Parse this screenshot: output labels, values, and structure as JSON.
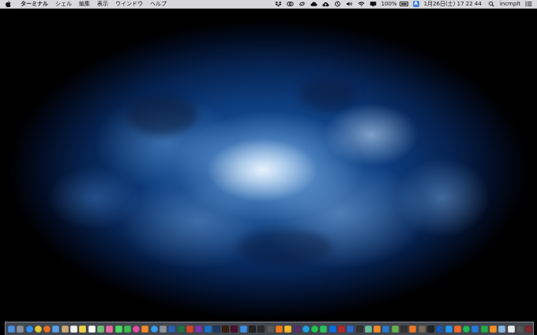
{
  "menubar": {
    "app_name": "ターミナル",
    "menus": [
      "シェル",
      "編集",
      "表示",
      "ウインドウ",
      "ヘルプ"
    ],
    "battery": "100%",
    "input_source": "A",
    "datetime": "1月26日(土)  17 22 44",
    "username": "incmplt"
  },
  "status_icons": [
    "dropbox-icon",
    "creative-cloud-icon",
    "sync-icon",
    "cloud-icon",
    "upload-icon",
    "time-machine-icon",
    "volume-icon",
    "wifi-icon",
    "display-icon"
  ],
  "dock": {
    "apps": [
      {
        "name": "finder",
        "color": "#4a90e2"
      },
      {
        "name": "launchpad",
        "color": "#8a8f98"
      },
      {
        "name": "safari",
        "color": "#2f8ef0"
      },
      {
        "name": "chrome",
        "color": "#e6c63a"
      },
      {
        "name": "firefox",
        "color": "#e8702a"
      },
      {
        "name": "mail",
        "color": "#5aa0e8"
      },
      {
        "name": "contacts",
        "color": "#c9a97a"
      },
      {
        "name": "calendar",
        "color": "#f2f2f2"
      },
      {
        "name": "notes",
        "color": "#f0d24a"
      },
      {
        "name": "reminders",
        "color": "#f5f5f5"
      },
      {
        "name": "maps",
        "color": "#6fbf73"
      },
      {
        "name": "photos",
        "color": "#e86aa0"
      },
      {
        "name": "messages",
        "color": "#4cd964"
      },
      {
        "name": "facetime",
        "color": "#3fb950"
      },
      {
        "name": "itunes",
        "color": "#e24fa0"
      },
      {
        "name": "ibooks",
        "color": "#f08a2a"
      },
      {
        "name": "app-store",
        "color": "#3aa0f0"
      },
      {
        "name": "preferences",
        "color": "#8d9199"
      },
      {
        "name": "word",
        "color": "#2b5fb4"
      },
      {
        "name": "excel",
        "color": "#217346"
      },
      {
        "name": "powerpoint",
        "color": "#d24726"
      },
      {
        "name": "onenote",
        "color": "#7b3aa8"
      },
      {
        "name": "outlook",
        "color": "#1a73c8"
      },
      {
        "name": "photoshop",
        "color": "#1e3a5f"
      },
      {
        "name": "illustrator",
        "color": "#3a1f0c"
      },
      {
        "name": "indesign",
        "color": "#4a1030"
      },
      {
        "name": "xcode",
        "color": "#3f8fe0"
      },
      {
        "name": "terminal",
        "color": "#222222"
      },
      {
        "name": "activity-monitor",
        "color": "#2a2a2a"
      },
      {
        "name": "console",
        "color": "#5a5a5a"
      },
      {
        "name": "vlc",
        "color": "#f07a1a"
      },
      {
        "name": "sketch",
        "color": "#f5b82e"
      },
      {
        "name": "slack",
        "color": "#5a2f6a"
      },
      {
        "name": "skype",
        "color": "#1fa3e0"
      },
      {
        "name": "line",
        "color": "#1fc74a"
      },
      {
        "name": "evernote",
        "color": "#2dbe60"
      },
      {
        "name": "dropbox",
        "color": "#0d6ddd"
      },
      {
        "name": "filezilla",
        "color": "#b22a2a"
      },
      {
        "name": "sourcetree",
        "color": "#2a6ac8"
      },
      {
        "name": "github",
        "color": "#333333"
      },
      {
        "name": "atom",
        "color": "#6bbf9a"
      },
      {
        "name": "sublime",
        "color": "#f28b2a"
      },
      {
        "name": "vscode",
        "color": "#2a7ac8"
      },
      {
        "name": "android-studio",
        "color": "#6ab04c"
      },
      {
        "name": "unity",
        "color": "#333333"
      },
      {
        "name": "blender",
        "color": "#e87a2a"
      },
      {
        "name": "gimp",
        "color": "#7a6a5a"
      },
      {
        "name": "inkscape",
        "color": "#222222"
      },
      {
        "name": "virtualbox",
        "color": "#1a5ab0"
      },
      {
        "name": "docker",
        "color": "#2496ed"
      },
      {
        "name": "postman",
        "color": "#f06a2a"
      },
      {
        "name": "spotify",
        "color": "#1db954"
      },
      {
        "name": "keynote",
        "color": "#2a7ad8"
      },
      {
        "name": "numbers",
        "color": "#2aa84a"
      },
      {
        "name": "pages",
        "color": "#f0902a"
      },
      {
        "name": "preview",
        "color": "#8ab4e0"
      },
      {
        "name": "textedit",
        "color": "#e8e8e8"
      },
      {
        "name": "calculator",
        "color": "#555555"
      },
      {
        "name": "dictionary",
        "color": "#7a2a2a"
      },
      {
        "name": "chess",
        "color": "#444444"
      },
      {
        "name": "quicktime",
        "color": "#1a3a6a"
      },
      {
        "name": "photo-booth",
        "color": "#a82a2a"
      },
      {
        "name": "image-capture",
        "color": "#3a6a9a"
      },
      {
        "name": "disk-utility",
        "color": "#9aa0a8"
      },
      {
        "name": "keychain",
        "color": "#b8a040"
      },
      {
        "name": "migration",
        "color": "#6a7a8a"
      }
    ],
    "stacks": [
      {
        "name": "applications-folder",
        "color": "#9aa4b0"
      },
      {
        "name": "downloads-folder",
        "color": "#7a8696"
      },
      {
        "name": "trash",
        "color": "#c8ccd2"
      }
    ]
  }
}
